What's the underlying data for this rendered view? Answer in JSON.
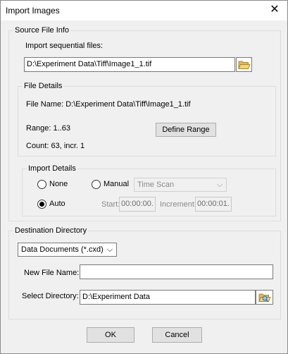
{
  "window": {
    "title": "Import Images",
    "close_symbol": "✕"
  },
  "source": {
    "legend": "Source File Info",
    "import_label": "Import sequential files:",
    "path_value": "D:\\Experiment Data\\Tiff\\Image1_1.tif",
    "browse_icon": "folder-icon"
  },
  "file_details": {
    "legend": "File Details",
    "file_name": "File Name: D:\\Experiment Data\\Tiff\\Image1_1.tif",
    "range": "Range: 1..63",
    "count": "Count: 63, incr. 1",
    "define_range_label": "Define Range"
  },
  "import_details": {
    "legend": "Import Details",
    "none_label": "None",
    "manual_label": "Manual",
    "auto_label": "Auto",
    "selected_mode": "Auto",
    "scan_select": "Time Scan",
    "start_label": "Start:",
    "start_value": "00:00:00.",
    "increment_label": "Increment:",
    "increment_value": "00:00:01."
  },
  "destination": {
    "legend": "Destination Directory",
    "type_select": "Data Documents (*.cxd)",
    "new_file_label": "New File Name:",
    "new_file_value": "",
    "select_dir_label": "Select Directory:",
    "select_dir_value": "D:\\Experiment Data",
    "browse_icon": "folder-search-icon"
  },
  "buttons": {
    "ok": "OK",
    "cancel": "Cancel"
  }
}
